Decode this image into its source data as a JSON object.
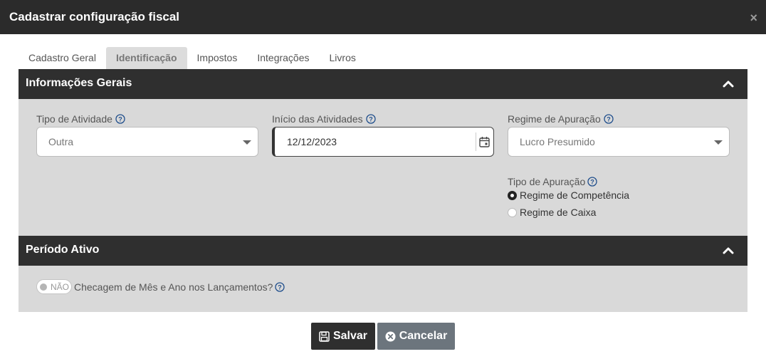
{
  "modal": {
    "title": "Cadastrar configuração fiscal",
    "close": "×"
  },
  "tabs": [
    {
      "label": "Cadastro Geral"
    },
    {
      "label": "Identificação"
    },
    {
      "label": "Impostos"
    },
    {
      "label": "Integrações"
    },
    {
      "label": "Livros"
    }
  ],
  "active_tab": "Identificação",
  "informacoes_gerais": {
    "title": "Informações Gerais",
    "tipo_atividade": {
      "label": "Tipo de Atividade",
      "value": "Outra"
    },
    "inicio_atividades": {
      "label": "Início das Atividades",
      "value": "12/12/2023"
    },
    "regime_apuracao": {
      "label": "Regime de Apuração",
      "value": "Lucro Presumido"
    },
    "tipo_apuracao": {
      "label": "Tipo de Apuração",
      "options": [
        {
          "label": "Regime de Competência",
          "checked": true
        },
        {
          "label": "Regime de Caixa",
          "checked": false
        }
      ]
    }
  },
  "periodo_ativo": {
    "title": "Período Ativo",
    "toggle": {
      "state_text": "NÃO",
      "label": "Checagem de Mês e Ano nos Lançamentos?"
    }
  },
  "buttons": {
    "save": "Salvar",
    "cancel": "Cancelar"
  },
  "colors": {
    "header": "#2b2b2b",
    "section_bg": "#d9d9d9",
    "cancel": "#6c757d",
    "help": "#1f4e8c"
  }
}
